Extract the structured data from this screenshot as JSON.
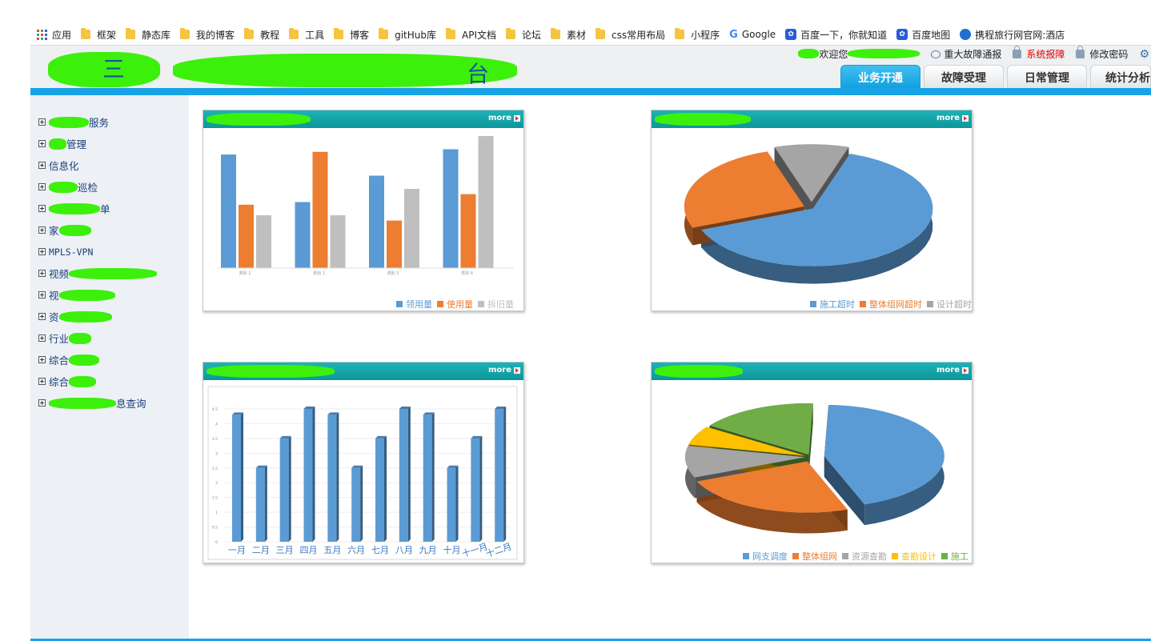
{
  "bookmarks": [
    {
      "label": "应用",
      "icon": "apps-icon"
    },
    {
      "label": "框架",
      "icon": "folder-icon"
    },
    {
      "label": "静态库",
      "icon": "folder-icon"
    },
    {
      "label": "我的博客",
      "icon": "folder-icon"
    },
    {
      "label": "教程",
      "icon": "folder-icon"
    },
    {
      "label": "工具",
      "icon": "folder-icon"
    },
    {
      "label": "博客",
      "icon": "folder-icon"
    },
    {
      "label": "gitHub库",
      "icon": "folder-icon"
    },
    {
      "label": "API文档",
      "icon": "folder-icon"
    },
    {
      "label": "论坛",
      "icon": "folder-icon"
    },
    {
      "label": "素材",
      "icon": "folder-icon"
    },
    {
      "label": "css常用布局",
      "icon": "folder-icon"
    },
    {
      "label": "小程序",
      "icon": "folder-icon"
    },
    {
      "label": "Google",
      "icon": "google-icon"
    },
    {
      "label": "百度一下，你就知道",
      "icon": "baidu-icon"
    },
    {
      "label": "百度地图",
      "icon": "baidu-icon"
    },
    {
      "label": "携程旅行网官网:酒店",
      "icon": "ctrip-icon"
    }
  ],
  "header": {
    "title_char_1": "三",
    "title_char_2": "台",
    "welcome": "欢迎您",
    "fault_notice": "重大故障通报",
    "system_report": "系统报障",
    "change_password": "修改密码"
  },
  "tabs": [
    {
      "label": "业务开通",
      "active": true
    },
    {
      "label": "故障受理",
      "active": false
    },
    {
      "label": "日常管理",
      "active": false
    },
    {
      "label": "统计分析",
      "active": false
    }
  ],
  "sidebar": {
    "items": [
      "服务",
      "管理",
      "信息化",
      "巡检",
      "单",
      "家",
      "MPLS-VPN",
      "视频",
      "视",
      "资",
      "行业",
      "综合",
      "综合",
      "息查询"
    ]
  },
  "panels": {
    "more_label": "more"
  },
  "chart_data": [
    {
      "type": "bar",
      "categories": [
        "类别 1",
        "类别 2",
        "类别 3",
        "类别 4"
      ],
      "series": [
        {
          "name": "领用量",
          "values": [
            4.3,
            2.5,
            3.5,
            4.5
          ]
        },
        {
          "name": "使用量",
          "values": [
            2.4,
            4.4,
            1.8,
            2.8
          ]
        },
        {
          "name": "拆旧量",
          "values": [
            2.0,
            2.0,
            3.0,
            5.0
          ]
        }
      ],
      "colors": [
        "#5b9bd5",
        "#ed7d31",
        "#bfbfbf"
      ],
      "ylim": [
        0,
        5
      ]
    },
    {
      "type": "pie",
      "categories": [
        "施工超时",
        "整体组网超时",
        "设计超时"
      ],
      "values": [
        64,
        26,
        10
      ],
      "colors": [
        "#5b9bd5",
        "#ed7d31",
        "#a5a5a5"
      ]
    },
    {
      "type": "bar",
      "categories": [
        "一月",
        "二月",
        "三月",
        "四月",
        "五月",
        "六月",
        "七月",
        "八月",
        "九月",
        "十月",
        "十一月",
        "十二月"
      ],
      "values": [
        4.3,
        2.5,
        3.5,
        4.5,
        4.3,
        2.5,
        3.5,
        4.5,
        4.3,
        2.5,
        3.5,
        4.5
      ],
      "yticks": [
        "0",
        "0.5",
        "1",
        "1.5",
        "2",
        "2.5",
        "3",
        "3.5",
        "4",
        "4.5"
      ],
      "ylim": [
        0,
        4.5
      ],
      "colors": [
        "#5b9bd5"
      ]
    },
    {
      "type": "pie",
      "categories": [
        "网支调度",
        "整体组网",
        "资源查勘",
        "查勘设计",
        "施工"
      ],
      "values": [
        44,
        24,
        10,
        6,
        16
      ],
      "colors": [
        "#5b9bd5",
        "#ed7d31",
        "#a5a5a5",
        "#ffc000",
        "#70ad47"
      ]
    }
  ]
}
